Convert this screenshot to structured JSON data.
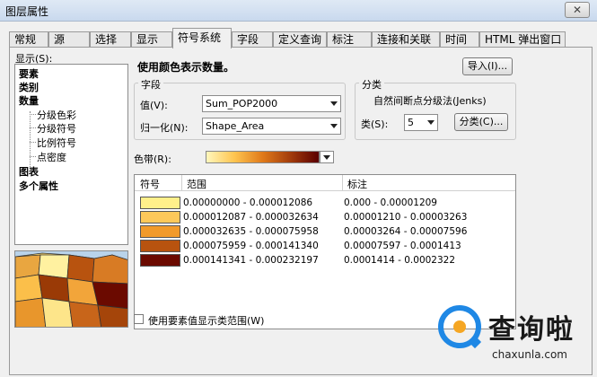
{
  "window": {
    "title": "图层属性",
    "close_glyph": "✕"
  },
  "tabs": [
    "常规",
    "源",
    "选择",
    "显示",
    "符号系统",
    "字段",
    "定义查询",
    "标注",
    "连接和关联",
    "时间",
    "HTML 弹出窗口"
  ],
  "active_tab": "符号系统",
  "show": {
    "label": "显示(S):",
    "tree": [
      {
        "label": "要素",
        "bold": true
      },
      {
        "label": "类别",
        "bold": true
      },
      {
        "label": "数量",
        "bold": true
      },
      {
        "label": "分级色彩",
        "bold": false
      },
      {
        "label": "分级符号",
        "bold": false
      },
      {
        "label": "比例符号",
        "bold": false
      },
      {
        "label": "点密度",
        "bold": false
      },
      {
        "label": "图表",
        "bold": true
      },
      {
        "label": "多个属性",
        "bold": true
      }
    ]
  },
  "description": "使用颜色表示数量。",
  "import_button": "导入(I)...",
  "fields": {
    "group_title": "字段",
    "value_label": "值(V):",
    "value": "Sum_POP2000",
    "normalize_label": "归一化(N):",
    "normalize": "Shape_Area"
  },
  "classification": {
    "group_title": "分类",
    "method": "自然间断点分级法(Jenks)",
    "classes_label": "类(S):",
    "classes": "5",
    "classify_button": "分类(C)..."
  },
  "color_ramp": {
    "label": "色带(R):"
  },
  "table": {
    "headers": [
      "符号",
      "范围",
      "标注"
    ],
    "rows": [
      {
        "color": "#fff08a",
        "range": "0.00000000 - 0.000012086",
        "label": "0.000 - 0.00001209"
      },
      {
        "color": "#fdc85a",
        "range": "0.000012087 - 0.000032634",
        "label": "0.00001210 - 0.00003263"
      },
      {
        "color": "#f19a2a",
        "range": "0.000032635 - 0.000075958",
        "label": "0.00003264 - 0.00007596"
      },
      {
        "color": "#b8530f",
        "range": "0.000075959 - 0.000141340",
        "label": "0.00007597 - 0.0001413"
      },
      {
        "color": "#6b0a00",
        "range": "0.000141341 - 0.000232197",
        "label": "0.0001414 - 0.0002322"
      }
    ]
  },
  "checkbox_label": "使用要素值显示类范围(W)",
  "watermark": {
    "brand": "查询啦",
    "url": "chaxunla.com"
  }
}
